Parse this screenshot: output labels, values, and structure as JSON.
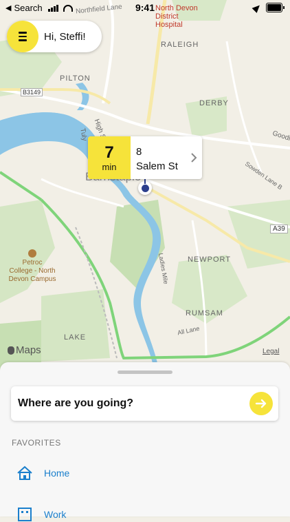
{
  "status_bar": {
    "back_label": "Search",
    "time": "9:41"
  },
  "header": {
    "greeting": "Hi, Steffi!"
  },
  "eta": {
    "minutes": "7",
    "unit": "min",
    "dest_number": "8",
    "dest_street": "Salem St"
  },
  "map": {
    "labels": {
      "northfield": "Northfield Lane",
      "hospital1": "North Devon",
      "hospital2": "District",
      "hospital3": "Hospital",
      "raleigh": "RALEIGH",
      "pilton": "PILTON",
      "derby": "DERBY",
      "b3149": "B3149",
      "high": "High S",
      "tuly": "Tuly",
      "goodle": "Goodle",
      "sowden": "Sowden Lane B",
      "barnstaple": "Barnstaple",
      "a39": "A39",
      "newport": "NEWPORT",
      "petroc1": "Petroc",
      "petroc2": "College - North",
      "petroc3": "Devon Campus",
      "ladies": "Ladies Mile",
      "rumsam": "RUMSAM",
      "alllane": "All Lane",
      "lake": "LAKE",
      "apple_maps": "Maps",
      "legal": "Legal"
    }
  },
  "sheet": {
    "search_label": "Where are you going?",
    "favorites_title": "FAVORITES",
    "favorites": [
      {
        "label": "Home",
        "icon": "home-icon"
      },
      {
        "label": "Work",
        "icon": "work-icon"
      }
    ]
  },
  "colors": {
    "accent": "#f6e33a",
    "link": "#1a7fcc",
    "water": "#8cc5e6",
    "park": "#c7dfb3",
    "motorway": "#7fd47a"
  }
}
